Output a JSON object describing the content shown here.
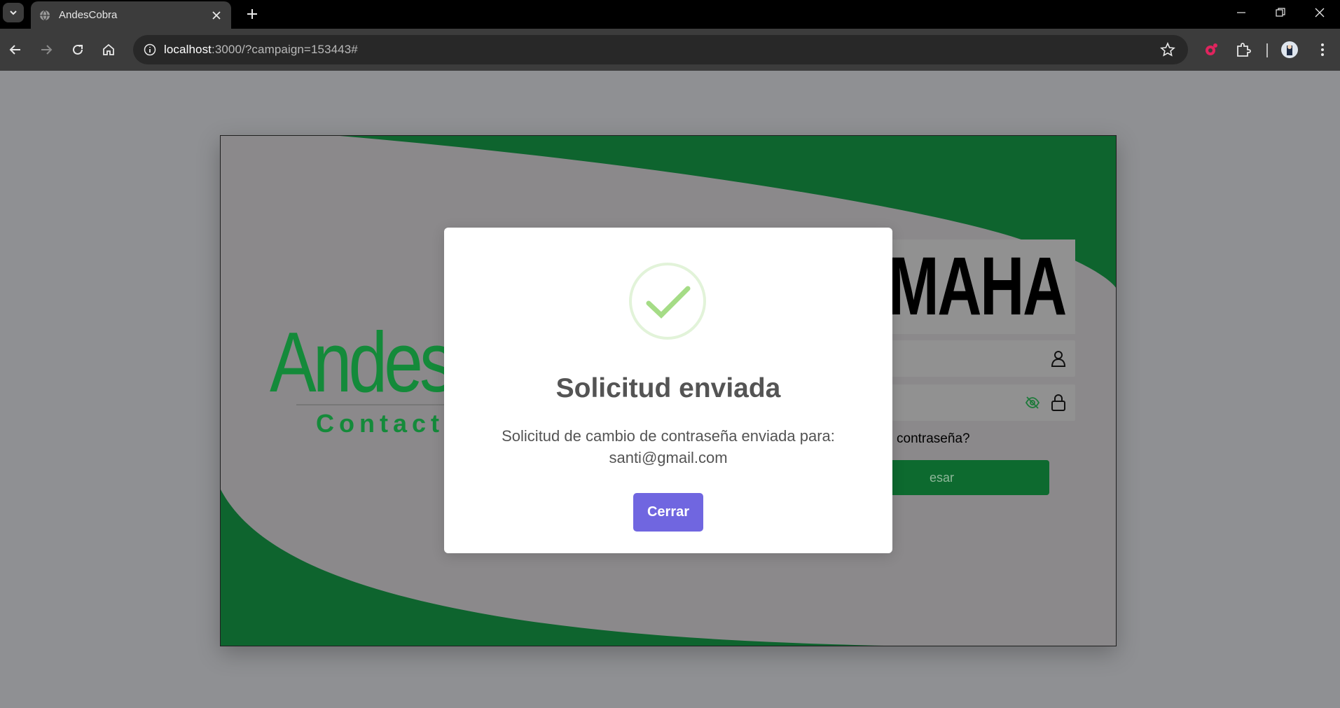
{
  "browser": {
    "tab_title": "AndesCobra",
    "url_host": "localhost",
    "url_path": ":3000/?campaign=153443#",
    "icons": [
      "tab-search-icon",
      "globe-icon",
      "close-icon",
      "plus-icon",
      "minimize-icon",
      "restore-icon",
      "window-close-icon",
      "back-icon",
      "forward-icon",
      "reload-icon",
      "home-icon",
      "info-icon",
      "star-icon",
      "extension-icon",
      "puzzle-icon",
      "profile-icon",
      "kebab-menu-icon"
    ]
  },
  "login": {
    "logo_main": "Andes",
    "logo_sub": "Contact c",
    "brand": "MAHA",
    "forgot_text": "contraseña?",
    "submit_label": "esar"
  },
  "modal": {
    "title": "Solicitud enviada",
    "message_line1": "Solicitud de cambio de contraseña enviada para:",
    "message_line2": "santi@gmail.com",
    "button_label": "Cerrar",
    "accent_color": "#7066e0",
    "success_color": "#a5dc86"
  },
  "colors": {
    "brand_green": "#0d6a2f",
    "overlay": "#8f9093"
  }
}
